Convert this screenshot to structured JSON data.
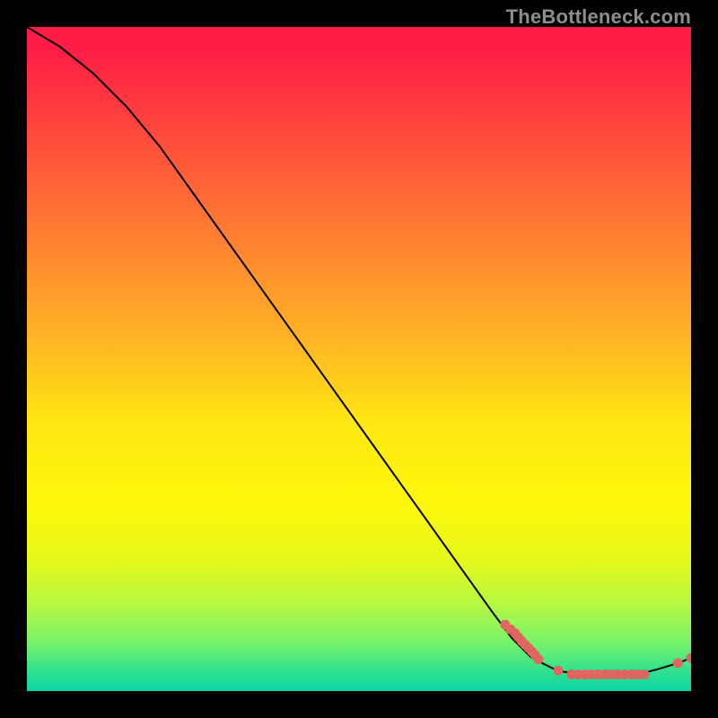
{
  "watermark": "TheBottleneck.com",
  "colors": {
    "curve_stroke": "#000000",
    "marker_fill": "#e06760",
    "gradient_top": "#ff1c46",
    "gradient_mid": "#ffe812",
    "gradient_bottom": "#0cd6a5"
  },
  "chart_data": {
    "type": "line",
    "title": "",
    "xlabel": "",
    "ylabel": "",
    "xlim": [
      0,
      100
    ],
    "ylim": [
      0,
      100
    ],
    "curve": {
      "x": [
        0,
        5,
        10,
        15,
        20,
        25,
        30,
        35,
        40,
        45,
        50,
        55,
        60,
        65,
        70,
        73,
        76,
        80,
        84,
        88,
        92,
        95,
        98,
        100
      ],
      "y": [
        100,
        97,
        93,
        88,
        82,
        75,
        68,
        61,
        54,
        47,
        40,
        33,
        26,
        19,
        12,
        8,
        5,
        3,
        2.5,
        2.5,
        2.5,
        3.3,
        4.2,
        5
      ]
    },
    "markers": {
      "x": [
        72,
        72.8,
        73.5,
        74,
        74.5,
        75,
        75.5,
        76,
        76.5,
        77,
        80,
        82,
        83,
        84,
        85,
        86,
        87,
        88,
        89,
        90,
        91,
        92,
        93,
        98,
        100
      ],
      "y": [
        10,
        9.3,
        8.7,
        8.1,
        7.5,
        7.0,
        6.5,
        6.0,
        5.4,
        4.8,
        3.1,
        2.5,
        2.5,
        2.5,
        2.5,
        2.5,
        2.5,
        2.5,
        2.5,
        2.5,
        2.5,
        2.5,
        2.5,
        4.2,
        5
      ]
    }
  }
}
